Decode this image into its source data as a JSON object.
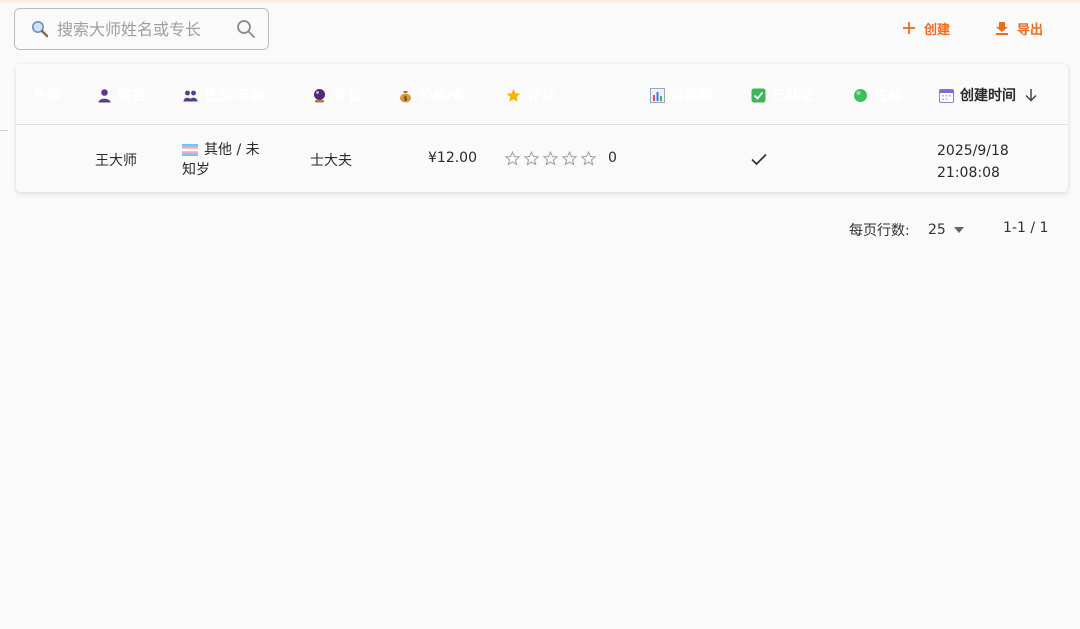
{
  "search": {
    "placeholder": "搜索大师姓名或专长"
  },
  "actions": {
    "create_label": "创建",
    "export_label": "导出"
  },
  "accent_color": "#f06a1a",
  "table": {
    "columns": [
      {
        "key": "avatar",
        "label": "头像",
        "icon": ""
      },
      {
        "key": "name",
        "label": "姓名",
        "icon": "person-icon"
      },
      {
        "key": "gender_age",
        "label": "性别/年龄",
        "icon": "people-icon"
      },
      {
        "key": "specialty",
        "label": "专长",
        "icon": "crystal-ball-icon"
      },
      {
        "key": "price",
        "label": "价格/条",
        "icon": "money-bag-icon"
      },
      {
        "key": "rating",
        "label": "评分",
        "icon": "star-icon"
      },
      {
        "key": "consults",
        "label": "咨询数",
        "icon": "bar-chart-icon"
      },
      {
        "key": "verified",
        "label": "已认证",
        "icon": "check-box-icon"
      },
      {
        "key": "online",
        "label": "在线",
        "icon": "green-circle-icon"
      },
      {
        "key": "created",
        "label": "创建时间",
        "icon": "calendar-icon"
      }
    ],
    "sort_indicator": "arrow-down-icon",
    "rows": [
      {
        "name": "王大师",
        "gender_line1": "其他 / 未",
        "gender_line2": "知岁",
        "gender_icon": "transgender-flag-icon",
        "specialty": "士大夫",
        "price": "¥12.00",
        "rating_count": "0",
        "rating_stars": 0,
        "verified": true,
        "created_line1": "2025/9/18",
        "created_line2": "21:08:08"
      }
    ]
  },
  "pagination": {
    "rows_per_page_label": "每页行数:",
    "rows_per_page_value": "25",
    "range": "1-1 / 1"
  }
}
